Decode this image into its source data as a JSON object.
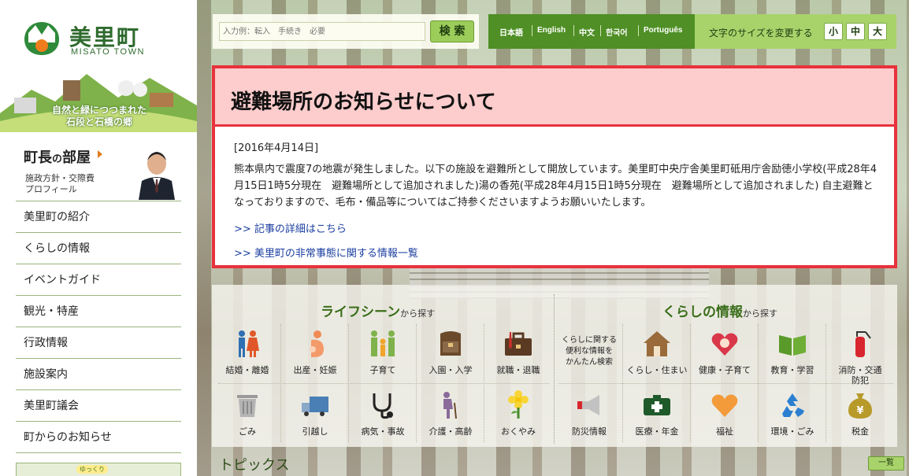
{
  "site": {
    "logo_name": "美里町",
    "logo_en": "MISATO TOWN",
    "tagline_line1": "自然と緑につつまれた",
    "tagline_line2": "石段と石橋の郷"
  },
  "mayor": {
    "title_main": "町長",
    "title_no": "の",
    "title_end": "部屋",
    "sub1": "施政方針・交際費",
    "sub2": "プロフィール"
  },
  "nav": {
    "items": [
      {
        "label": "美里町の紹介"
      },
      {
        "label": "くらしの情報"
      },
      {
        "label": "イベントガイド"
      },
      {
        "label": "観光・特産"
      },
      {
        "label": "行政情報"
      },
      {
        "label": "施設案内"
      },
      {
        "label": "美里町議会"
      },
      {
        "label": "町からのお知らせ"
      }
    ],
    "banner_text": "ゆっくり"
  },
  "search": {
    "placeholder": "入力例：転入　手続き　必要",
    "button_label": "検 索"
  },
  "languages": [
    "日本語",
    "English",
    "中文",
    "한국어",
    "Português"
  ],
  "font_size": {
    "label": "文字のサイズを変更する",
    "small": "小",
    "medium": "中",
    "large": "大"
  },
  "notice": {
    "title": "避難場所のお知らせについて",
    "date": "[2016年4月14日]",
    "body": "熊本県内で震度7の地震が発生しました。以下の施設を避難所として開放しています。美里町中央庁舎美里町砥用庁舎励徳小学校(平成28年4月15日1時5分現在　避難場所として追加されました)湯の香苑(平成28年4月15日1時5分現在　避難場所として追加されました) 自主避難となっておりますので、毛布・備品等についてはご持参くださいますようお願いいたします。",
    "link1": ">> 記事の詳細はこちら",
    "link2": ">> 美里町の非常事態に関する情報一覧"
  },
  "life_scene": {
    "heading": "ライフシーン",
    "heading_suffix": "から探す",
    "items": [
      {
        "label": "結婚・離婚",
        "icon": "couple-icon"
      },
      {
        "label": "出産・妊娠",
        "icon": "pregnancy-icon"
      },
      {
        "label": "子育て",
        "icon": "family-icon"
      },
      {
        "label": "入園・入学",
        "icon": "school-bag-icon"
      },
      {
        "label": "就職・退職",
        "icon": "briefcase-icon"
      },
      {
        "label": "ごみ",
        "icon": "trash-can-icon"
      },
      {
        "label": "引越し",
        "icon": "moving-truck-icon"
      },
      {
        "label": "病気・事故",
        "icon": "stethoscope-icon"
      },
      {
        "label": "介護・高齢",
        "icon": "elderly-icon"
      },
      {
        "label": "おくやみ",
        "icon": "chrysanthemum-icon"
      }
    ]
  },
  "living_info": {
    "heading": "くらしの情報",
    "heading_suffix": "から探す",
    "search_note_1": "くらしに関する",
    "search_note_2": "便利な情報を",
    "search_note_3": "かんたん検索",
    "items": [
      {
        "label": "くらし・住まい",
        "icon": "house-icon"
      },
      {
        "label": "健康・子育て",
        "icon": "heart-face-icon"
      },
      {
        "label": "教育・学習",
        "icon": "book-icon"
      },
      {
        "label_1": "消防・交通",
        "label_2": "防犯",
        "icon": "fire-extinguisher-icon"
      },
      {
        "label": "防災情報",
        "icon": "megaphone-icon"
      },
      {
        "label": "医療・年金",
        "icon": "first-aid-kit-icon"
      },
      {
        "label": "福祉",
        "icon": "heart-icon"
      },
      {
        "label": "環境・ごみ",
        "icon": "recycle-icon"
      },
      {
        "label": "税金",
        "icon": "yen-bag-icon"
      }
    ]
  },
  "topics": {
    "title": "トピックス",
    "more_label": "一覧"
  },
  "colors": {
    "brand_green": "#2f6b2f",
    "alert_red": "#e8323c",
    "alert_pink": "#fdcccc",
    "link_blue": "#1b3fa0",
    "lang_bar": "#4f8f25",
    "size_bar": "#a8d36b"
  }
}
